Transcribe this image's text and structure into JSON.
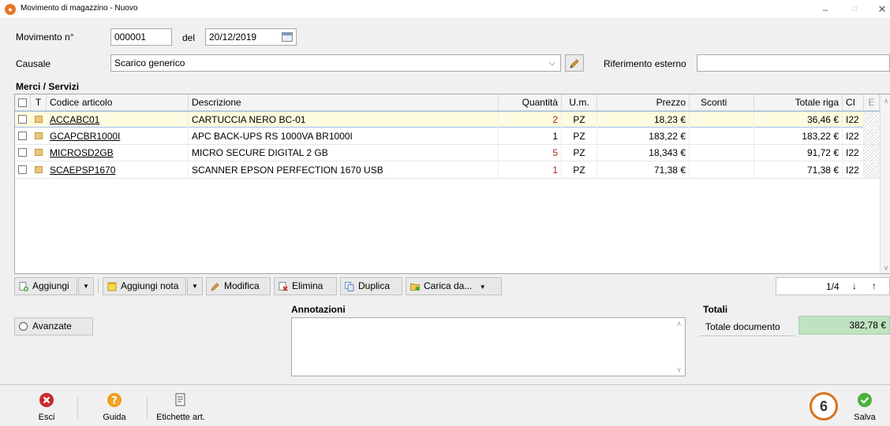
{
  "window": {
    "title": "Movimento di magazzino - Nuovo",
    "controls": {
      "minimize": "–",
      "maximize": "□",
      "close": "✕"
    }
  },
  "header": {
    "movimento_label": "Movimento n°",
    "movimento_value": "000001",
    "del_label": "del",
    "date_value": "20/12/2019",
    "causale_label": "Causale",
    "causale_value": "Scarico generico",
    "riferimento_label": "Riferimento esterno",
    "riferimento_value": ""
  },
  "grid": {
    "section_title": "Merci / Servizi",
    "columns": {
      "t": "T",
      "codice": "Codice articolo",
      "descrizione": "Descrizione",
      "quantita": "Quantità",
      "um": "U.m.",
      "prezzo": "Prezzo",
      "sconti": "Sconti",
      "totale": "Totale riga",
      "ci": "CI",
      "e": "E"
    },
    "rows": [
      {
        "codice": "ACCABC01",
        "descrizione": "CARTUCCIA NERO BC-01",
        "quantita": "2",
        "um": "PZ",
        "prezzo": "18,23 €",
        "sconti": "",
        "totale": "36,46 €",
        "ci": "I22"
      },
      {
        "codice": "GCAPCBR1000I",
        "descrizione": "APC BACK-UPS RS 1000VA BR1000I",
        "quantita": "1",
        "um": "PZ",
        "prezzo": "183,22 €",
        "sconti": "",
        "totale": "183,22 €",
        "ci": "I22"
      },
      {
        "codice": "MICROSD2GB",
        "descrizione": "MICRO SECURE DIGITAL  2 GB",
        "quantita": "5",
        "um": "PZ",
        "prezzo": "18,343 €",
        "sconti": "",
        "totale": "91,72 €",
        "ci": "I22"
      },
      {
        "codice": "SCAEPSP1670",
        "descrizione": "SCANNER EPSON PERFECTION 1670 USB",
        "quantita": "1",
        "um": "PZ",
        "prezzo": "71,38 €",
        "sconti": "",
        "totale": "71,38 €",
        "ci": "I22"
      }
    ]
  },
  "toolbar": {
    "aggiungi": "Aggiungi",
    "aggiungi_nota": "Aggiungi nota",
    "modifica": "Modifica",
    "elimina": "Elimina",
    "duplica": "Duplica",
    "carica_da": "Carica da...",
    "pager": "1/4"
  },
  "lower": {
    "avanzate": "Avanzate",
    "annotazioni_title": "Annotazioni",
    "totali_title": "Totali",
    "totale_documento_label": "Totale documento",
    "totale_documento_value": "382,78 €"
  },
  "bottom": {
    "esci": "Esci",
    "guida": "Guida",
    "etichette": "Etichette art.",
    "salva": "Salva",
    "step_badge": "6"
  },
  "colors": {
    "selected_row": "#fdfbe0",
    "total_bg": "#bfe3c1",
    "badge_border": "#d9731e",
    "esci_red": "#c8282c",
    "guida_orange": "#f0a020",
    "salva_green": "#4caf3e"
  }
}
